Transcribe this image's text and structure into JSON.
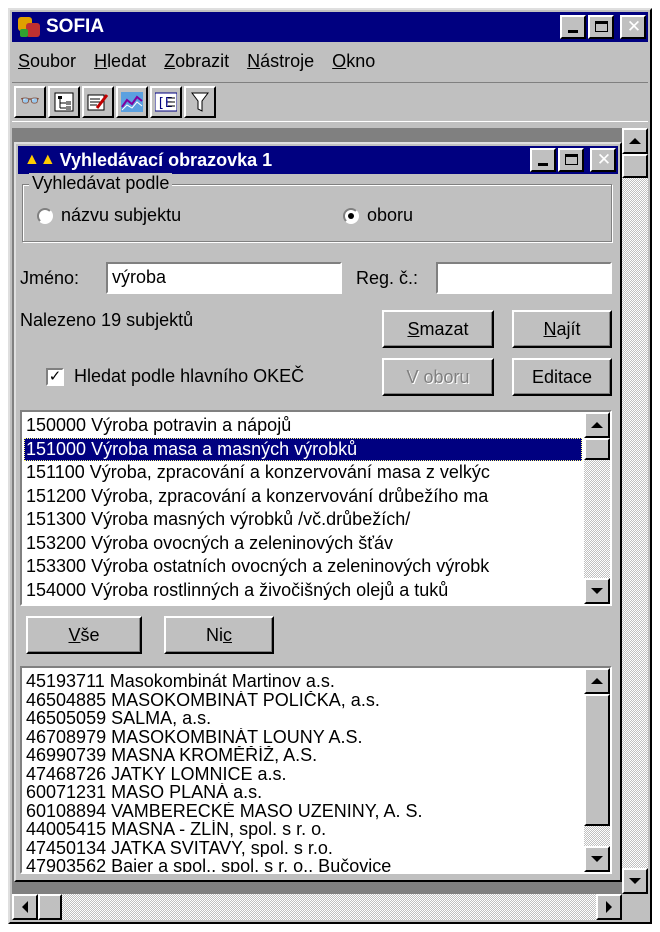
{
  "app": {
    "title": "SOFIA"
  },
  "menu": [
    {
      "key": "S",
      "rest": "oubor"
    },
    {
      "key": "H",
      "rest": "ledat"
    },
    {
      "key": "Z",
      "rest": "obrazit"
    },
    {
      "key": "N",
      "rest": "ástroje"
    },
    {
      "key": "O",
      "rest": "kno"
    }
  ],
  "toolbar_icons": [
    "binoculars-icon",
    "tree-icon",
    "edit-icon",
    "chart-icon",
    "list-icon",
    "filter-icon"
  ],
  "child": {
    "title": "Vyhledávací obrazovka 1",
    "group_label": "Vyhledávat podle",
    "radio_name_label": "názvu subjektu",
    "radio_field_label": "oboru",
    "selected_radio": "oboru",
    "name_label": "Jméno:",
    "name_value": "výroba",
    "reg_label": "Reg. č.:",
    "reg_value": "",
    "found_text": "Nalezeno 19 subjektů",
    "btn_clear_key": "S",
    "btn_clear_rest": "mazat",
    "btn_find_key": "N",
    "btn_find_rest": "ajít",
    "checkbox_label": "Hledat podle hlavního OKEČ",
    "checkbox_checked": true,
    "btn_in_field": "V oboru",
    "btn_edit": "Editace",
    "btn_all_key": "V",
    "btn_all_rest": "še",
    "btn_none_pre": "Ni",
    "btn_none_key": "c"
  },
  "okec_list": [
    "150000 Výroba potravin a nápojů",
    "151000 Výroba masa a masných výrobků",
    "151100 Výroba, zpracování a konzervování masa z velkýc",
    "151200 Výroba, zpracování a konzervování drůbežího ma",
    "151300 Výroba masných výrobků /vč.drůbežích/",
    "153200 Výroba ovocných a zeleninových šťáv",
    "153300 Výroba ostatních ovocných a zeleninových výrobk",
    "154000 Výroba rostlinných a živočišných olejů a tuků"
  ],
  "okec_selected_index": 1,
  "subjects": [
    "45193711 Masokombinát Martinov a.s.",
    "46504885 MASOKOMBINÁT POLIČKA, a.s.",
    "46505059 SALMA, a.s.",
    "46708979 MASOKOMBINÁT LOUNY A.S.",
    "46990739 MASNA KROMĚŘÍŽ, A.S.",
    "47468726 JATKY LOMNICE a.s.",
    "60071231 MASO PLANÁ a.s.",
    "60108894 VAMBERECKÉ MASO UZENINY, A. S.",
    "44005415 MASNA - ZLÍN, spol. s r. o.",
    "47450134 JATKA SVITAVY, spol. s r.o.",
    "47903562 Bajer a spol., spol. s r. o., Bučovice"
  ]
}
